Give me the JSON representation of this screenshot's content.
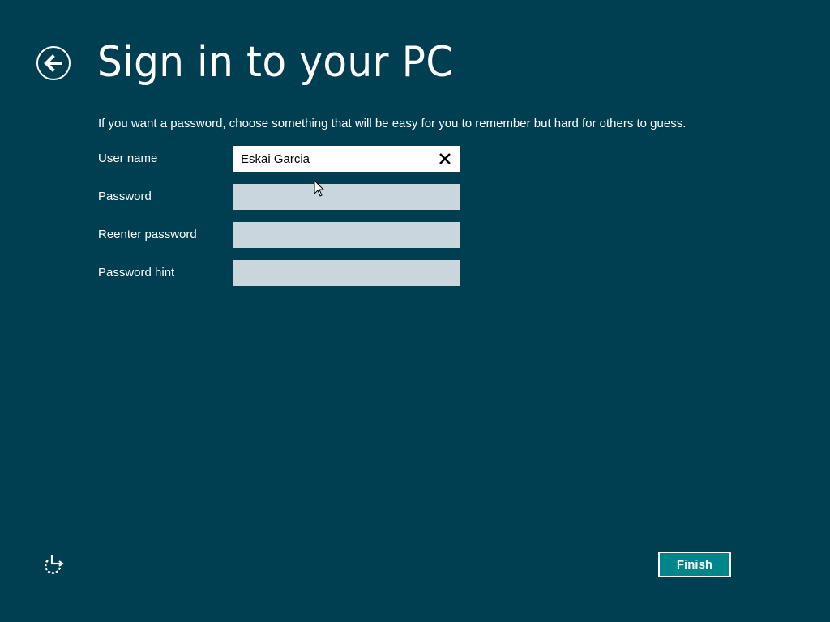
{
  "header": {
    "back_icon": "back-arrow-circle-icon",
    "title": "Sign in to your PC"
  },
  "intro_text": "If you want a password, choose something that will be easy for you to remember but hard for others to guess.",
  "form": {
    "fields": [
      {
        "label": "User name",
        "value": "Eskai Garcia",
        "placeholder": ""
      },
      {
        "label": "Password",
        "value": "",
        "placeholder": ""
      },
      {
        "label": "Reenter password",
        "value": "",
        "placeholder": ""
      },
      {
        "label": "Password hint",
        "value": "",
        "placeholder": ""
      }
    ],
    "clear_icon": "close-x-icon"
  },
  "footer": {
    "ease_of_access_icon": "ease-of-access-icon",
    "finish_label": "Finish"
  },
  "colors": {
    "background": "#003f51",
    "button_fill": "#00858a",
    "input_inactive": "#c9d7dc",
    "input_active": "#ffffff"
  }
}
